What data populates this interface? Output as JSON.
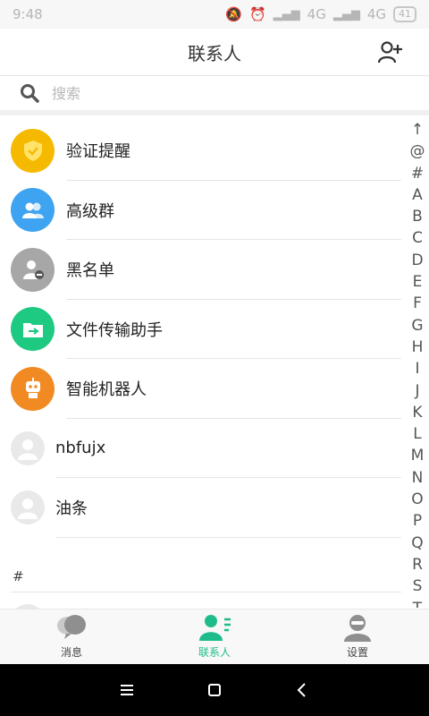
{
  "status": {
    "time": "9:48",
    "network_1": "4G",
    "network_2": "4G",
    "battery": "41"
  },
  "header": {
    "title": "联系人",
    "add_icon": "add-friend-icon"
  },
  "search": {
    "placeholder": "搜索",
    "icon": "search-icon"
  },
  "system_items": [
    {
      "label": "验证提醒",
      "icon": "shield-icon",
      "color": "#f5b900"
    },
    {
      "label": "高级群",
      "icon": "group-icon",
      "color": "#3ea3f0"
    },
    {
      "label": "黑名单",
      "icon": "blocked-user-icon",
      "color": "#a7a7a7"
    },
    {
      "label": "文件传输助手",
      "icon": "folder-transfer-icon",
      "color": "#1ec981"
    },
    {
      "label": "智能机器人",
      "icon": "robot-icon",
      "color": "#f28a23"
    }
  ],
  "contacts": [
    {
      "name": "nbfujx",
      "icon": "default-avatar-icon"
    },
    {
      "name": "油条",
      "icon": "default-avatar-icon"
    }
  ],
  "section_header": "#",
  "index": [
    "↑",
    "@",
    "#",
    "A",
    "B",
    "C",
    "D",
    "E",
    "F",
    "G",
    "H",
    "I",
    "J",
    "K",
    "L",
    "M",
    "N",
    "O",
    "P",
    "Q",
    "R",
    "S",
    "T"
  ],
  "tabs": [
    {
      "label": "消息",
      "icon": "chat-bubbles-icon",
      "active": false
    },
    {
      "label": "联系人",
      "icon": "contacts-icon",
      "active": true
    },
    {
      "label": "设置",
      "icon": "settings-avatar-icon",
      "active": false
    }
  ],
  "colors": {
    "accent": "#1fbc8b",
    "tab_inactive": "#8f8f8f"
  }
}
